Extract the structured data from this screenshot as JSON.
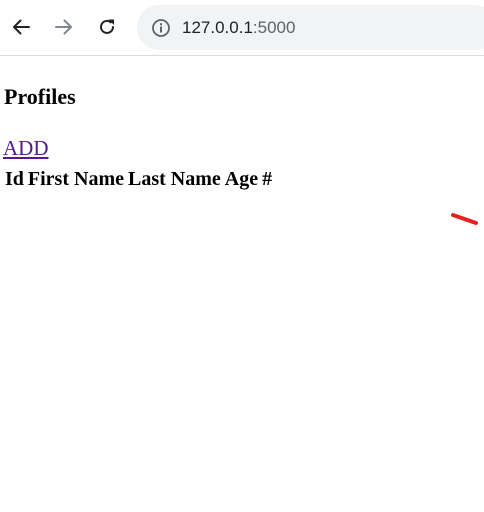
{
  "browser": {
    "url_host": "127.0.0.1",
    "url_port": ":5000",
    "icons": {
      "back": "arrow-left-icon",
      "forward": "arrow-right-icon",
      "reload": "reload-icon",
      "site_info": "info-icon"
    }
  },
  "page": {
    "title": "Profiles",
    "add_link": "ADD",
    "table": {
      "headers": [
        "Id",
        "First Name",
        "Last Name",
        "Age",
        "#"
      ]
    }
  },
  "colors": {
    "link": "#551a8b",
    "annotation": "#e8201e",
    "omnibox_bg": "#f1f3f4"
  }
}
